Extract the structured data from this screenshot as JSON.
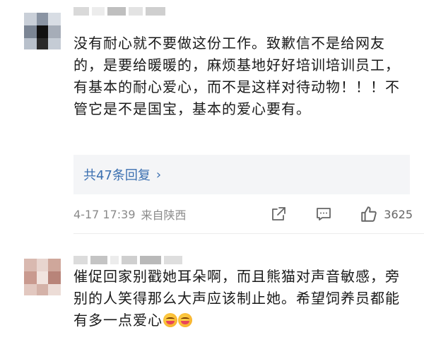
{
  "comments": [
    {
      "text": "没有耐心就不要做这份工作。致歉信不是给网友的，是要给暖暖的，麻烦基地好好培训培训员工，有基本的耐心爱心，而不是这样对待动物！！！不管它是不是国宝，基本的爱心要有。",
      "replies_label": "共47条回复",
      "replies_chevron": "›",
      "date": "4-17 17:39",
      "location": "来自陕西",
      "likes": "3625",
      "icons": [
        "share-icon",
        "comment-icon",
        "like-icon"
      ]
    },
    {
      "text": "催促回家别戳她耳朵啊，而且熊猫对声音敏感，旁别的人笑得那么大声应该制止她。希望饲养员都能有多一点爱心",
      "emoji_count": 2
    }
  ],
  "colors": {
    "link": "#3a6fb0",
    "meta": "#8a8a8a",
    "reply_bg": "#f4f5f7"
  }
}
